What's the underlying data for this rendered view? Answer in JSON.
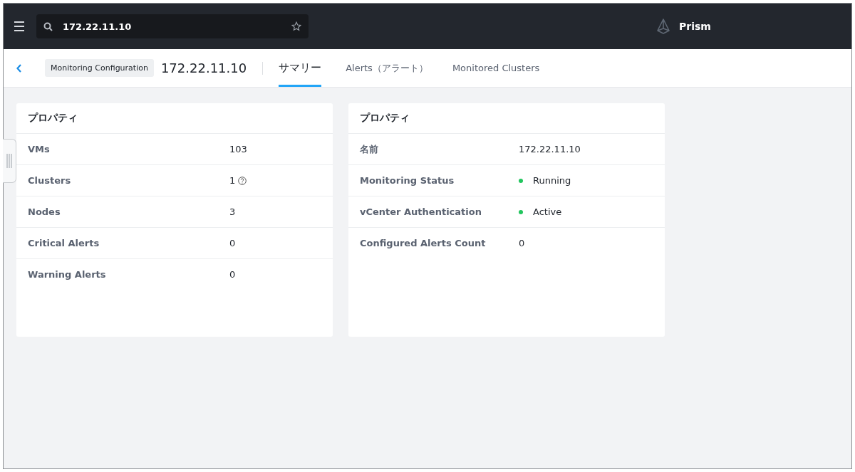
{
  "topbar": {
    "search": {
      "value": "172.22.11.10"
    },
    "brand": "Prism"
  },
  "nav": {
    "breadcrumb": "Monitoring Configuration",
    "title": "172.22.11.10",
    "tabs": [
      {
        "label": "サマリー",
        "selected": true
      },
      {
        "label": "Alerts（アラート）",
        "selected": false
      },
      {
        "label": "Monitored Clusters",
        "selected": false
      }
    ]
  },
  "cards": [
    {
      "title": "プロパティ",
      "rows": [
        {
          "kind": "text",
          "label": "VMs",
          "value": "103"
        },
        {
          "kind": "help",
          "label": "Clusters",
          "value": "1"
        },
        {
          "kind": "text",
          "label": "Nodes",
          "value": "3"
        },
        {
          "kind": "text",
          "label": "Critical Alerts",
          "value": "0"
        },
        {
          "kind": "text",
          "label": "Warning Alerts",
          "value": "0"
        }
      ]
    },
    {
      "title": "プロパティ",
      "rows": [
        {
          "kind": "text",
          "label": "名前",
          "value": "172.22.11.10"
        },
        {
          "kind": "status",
          "label": "Monitoring Status",
          "value": "Running",
          "color": "#22c55e"
        },
        {
          "kind": "status",
          "label": "vCenter Authentication",
          "value": "Active",
          "color": "#22c55e"
        },
        {
          "kind": "text",
          "label": "Configured Alerts Count",
          "value": "0"
        }
      ]
    }
  ]
}
